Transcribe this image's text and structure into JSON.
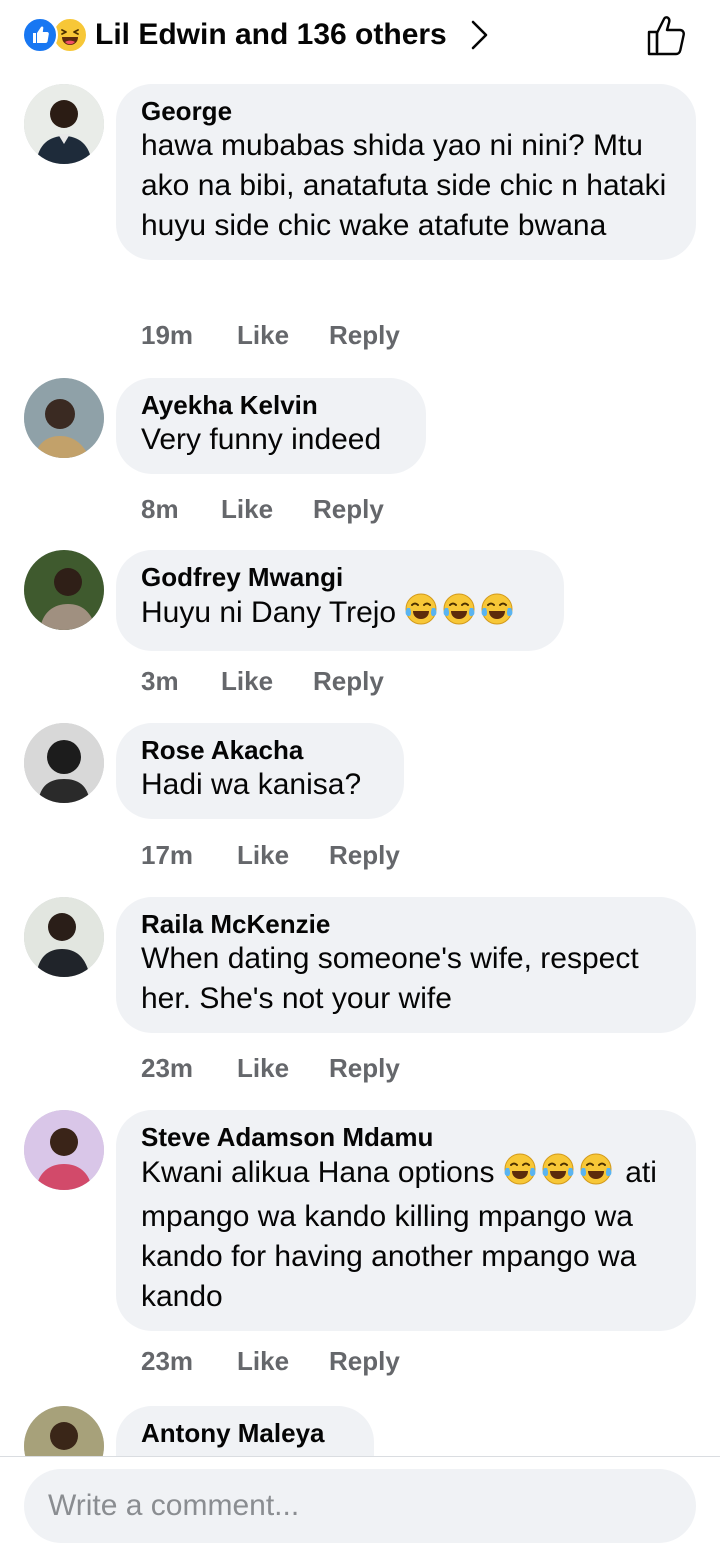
{
  "header": {
    "reactions_text": "Lil Edwin and 136 others",
    "reaction_icons": [
      "like-icon",
      "haha-icon"
    ],
    "like_button_icon": "thumbs-up-outline-icon"
  },
  "comments": [
    {
      "author": "George",
      "text": "hawa mubabas shida yao ni nini? Mtu ako na bibi, anatafuta side chic n hataki huyu side chic wake atafute bwana",
      "time": "19m",
      "like_label": "Like",
      "reply_label": "Reply"
    },
    {
      "author": "Ayekha Kelvin",
      "text": "Very funny indeed",
      "time": "8m",
      "like_label": "Like",
      "reply_label": "Reply"
    },
    {
      "author": "Godfrey Mwangi",
      "text": "Huyu ni Dany Trejo",
      "emojis": [
        "tears-of-joy-icon",
        "tears-of-joy-icon",
        "tears-of-joy-icon"
      ],
      "time": "3m",
      "like_label": "Like",
      "reply_label": "Reply"
    },
    {
      "author": "Rose Akacha",
      "text": "Hadi wa kanisa?",
      "time": "17m",
      "like_label": "Like",
      "reply_label": "Reply"
    },
    {
      "author": "Raila McKenzie",
      "text": "When dating someone's wife, respect her. She's not your wife",
      "time": "23m",
      "like_label": "Like",
      "reply_label": "Reply"
    },
    {
      "author": "Steve Adamson Mdamu",
      "text_before_emoji": "Kwani alikua Hana options",
      "emojis": [
        "tears-of-joy-icon",
        "tears-of-joy-icon",
        "tears-of-joy-icon"
      ],
      "text_after_emoji": "ati mpango wa kando killing mpango wa kando for having another mpango wa kando",
      "time": "23m",
      "like_label": "Like",
      "reply_label": "Reply"
    },
    {
      "author": "Antony Maleya"
    }
  ],
  "composer": {
    "placeholder": "Write a comment..."
  },
  "colors": {
    "bubble": "#f0f2f5",
    "meta_text": "#65676b",
    "facebook_blue": "#1877f2",
    "haha_yellow": "#f7c737"
  }
}
